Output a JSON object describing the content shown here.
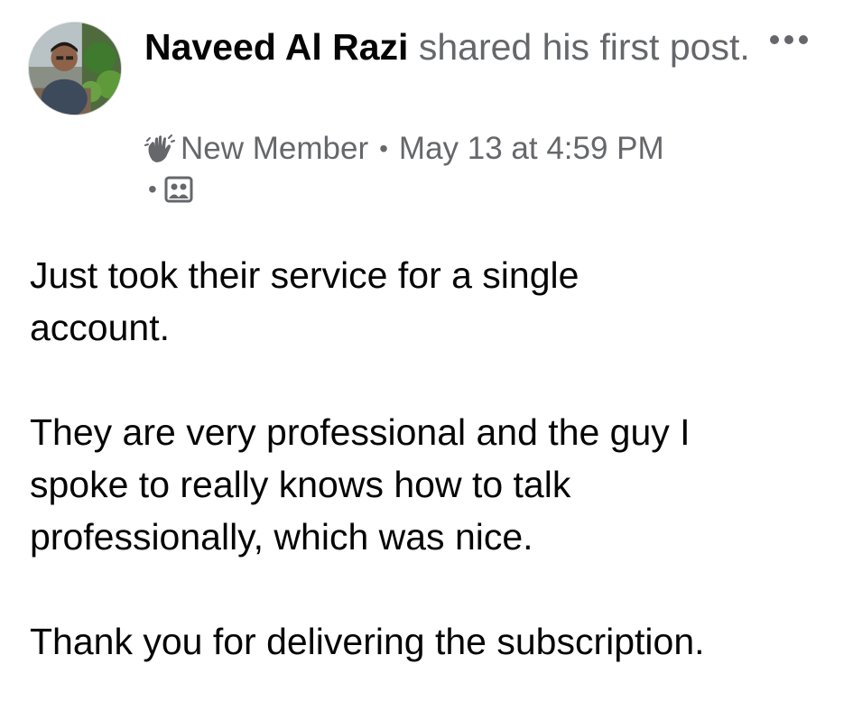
{
  "post": {
    "author": "Naveed Al Razi",
    "action_text": "shared his first post.",
    "badge_icon": "waving-hand-icon",
    "badge": "New Member",
    "separator": "•",
    "timestamp": "May 13 at 4:59 PM",
    "audience_icon": "group-members-icon",
    "more_icon": "more-options-icon",
    "paragraphs": [
      "Just took their service for a single\naccount.",
      "They are very professional and the guy I\nspoke to really knows how to talk\nprofessionally, which was nice.",
      "Thank you for delivering the subscription."
    ]
  }
}
